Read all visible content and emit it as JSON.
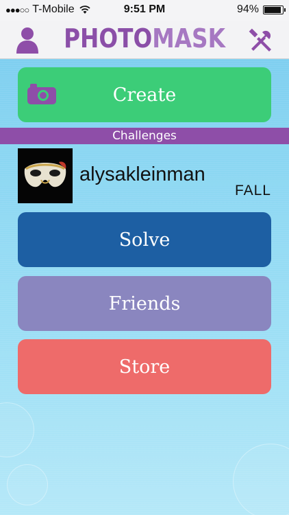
{
  "status_bar": {
    "signal": "●●●○○",
    "carrier": "T-Mobile",
    "time": "9:51 PM",
    "battery_percent": "94%",
    "battery_level": 0.94
  },
  "nav": {
    "title_part1": "PHOTO",
    "title_part2": "MASK",
    "profile_icon": "person-icon",
    "settings_icon": "tools-icon"
  },
  "buttons": {
    "create": "Create",
    "solve": "Solve",
    "friends": "Friends",
    "store": "Store"
  },
  "section": {
    "challenges": "Challenges"
  },
  "challenge": {
    "username": "alysakleinman",
    "status": "FALL"
  },
  "colors": {
    "accent": "#8e4ea8",
    "create": "#3ccd78",
    "solve": "#1d5fa3",
    "friends": "#8a86bf",
    "store": "#ee6b6a"
  }
}
